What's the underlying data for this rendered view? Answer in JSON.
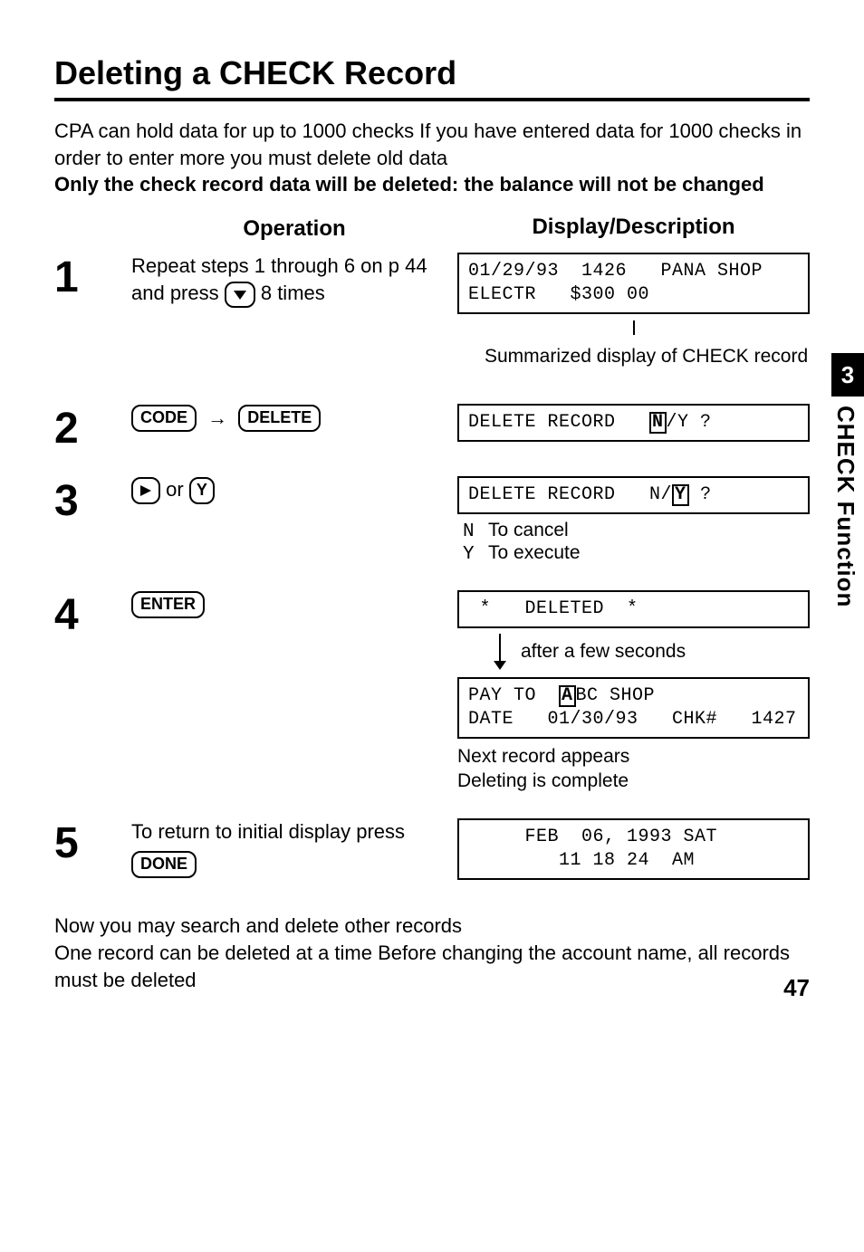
{
  "title": "Deleting a CHECK Record",
  "intro_line1": "CPA can hold data for up to 1000 checks  If you have entered data for 1000 checks in order to enter more you must delete old data",
  "intro_bold": "Only the check record data will be deleted:  the balance will not be changed",
  "headers": {
    "operation": "Operation",
    "display": "Display/Description"
  },
  "steps": {
    "s1": {
      "num": "1",
      "op_a": "Repeat steps 1 through 6 on p  44 and press ",
      "op_b": " 8 times",
      "key_down": "▼",
      "lcd": "01/29/93  1426   PANA SHOP\nELECTR   $300 00",
      "note": "Summarized display of CHECK record"
    },
    "s2": {
      "num": "2",
      "key_code": "CODE",
      "key_delete": "DELETE",
      "lcd_a": "DELETE RECORD   ",
      "lcd_n": "N",
      "lcd_slash": "/Y ?"
    },
    "s3": {
      "num": "3",
      "key_right": "▶",
      "or": " or ",
      "key_y": "Y",
      "lcd_a": "DELETE RECORD   N/",
      "lcd_y": "Y",
      "lcd_b": " ?",
      "n_label": "N",
      "n_text": "To cancel",
      "y_label": "Y",
      "y_text": "To execute"
    },
    "s4": {
      "num": "4",
      "key_enter": "ENTER",
      "lcd1": " *   DELETED  *",
      "after": "after a few seconds",
      "lcd2_a": "PAY TO  ",
      "lcd2_hl": "A",
      "lcd2_b": "BC SHOP\nDATE   01/30/93   CHK#   1427",
      "note": "Next record appears\nDeleting is complete"
    },
    "s5": {
      "num": "5",
      "op": "To return to initial display press",
      "key_done": "DONE",
      "lcd": "     FEB  06, 1993 SAT\n        11 18 24  AM"
    }
  },
  "footer": "Now you may search and delete other records\nOne record can be deleted at a time  Before changing the account name, all records must be deleted",
  "page_number": "47",
  "tab": {
    "num": "3",
    "label": "CHECK Function"
  }
}
